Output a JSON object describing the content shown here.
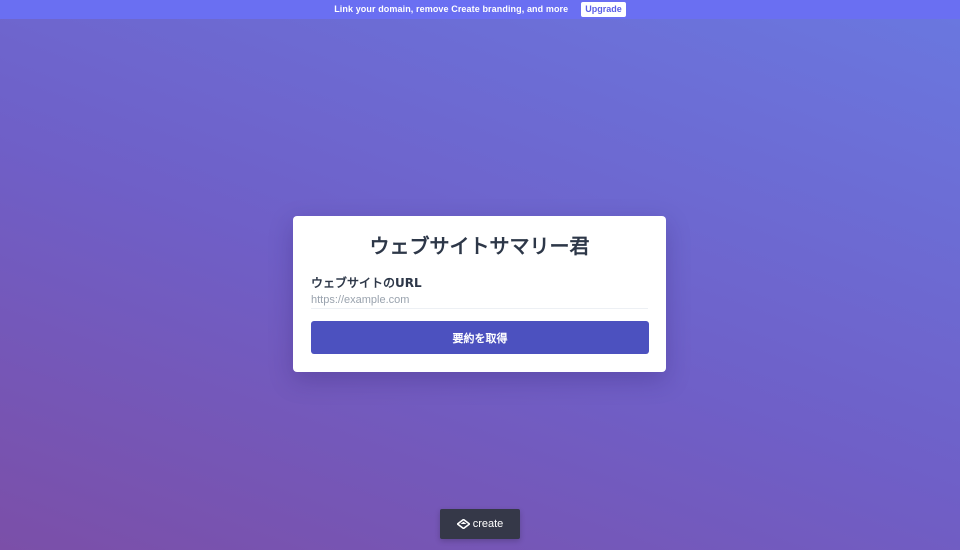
{
  "banner": {
    "text": "Link your domain, remove Create branding, and more",
    "upgrade_label": "Upgrade"
  },
  "card": {
    "title": "ウェブサイトサマリー君",
    "url_label": "ウェブサイトのURL",
    "url_placeholder": "https://example.com",
    "url_value": "",
    "submit_label": "要約を取得"
  },
  "badge": {
    "icon": "create-logo-icon",
    "label": "create"
  },
  "colors": {
    "banner_bg": "#6a6ff2",
    "button_bg": "#4c51bf",
    "badge_bg": "#353848"
  }
}
